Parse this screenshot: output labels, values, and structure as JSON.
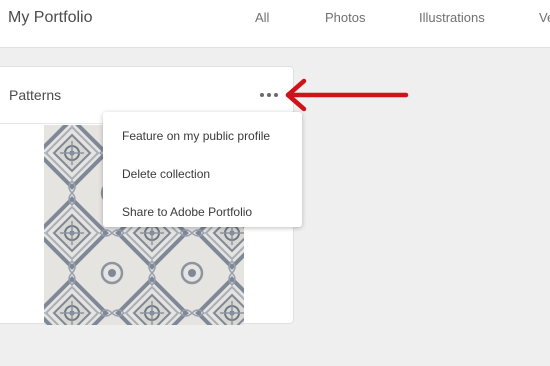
{
  "header": {
    "title": "My Portfolio",
    "tabs": [
      {
        "label": "All"
      },
      {
        "label": "Photos"
      },
      {
        "label": "Illustrations"
      },
      {
        "label": "Ve"
      }
    ]
  },
  "collection": {
    "title": "Patterns",
    "more_icon": "ellipsis-icon"
  },
  "context_menu": {
    "items": [
      {
        "label": "Feature on my public profile"
      },
      {
        "label": "Delete collection"
      },
      {
        "label": "Share to Adobe Portfolio"
      }
    ]
  },
  "annotation": {
    "icon": "arrow-left-icon",
    "color": "#d0131b"
  },
  "colors": {
    "background": "#efefef",
    "pattern_light": "#e6e4e0",
    "pattern_dark": "#7f8897"
  }
}
